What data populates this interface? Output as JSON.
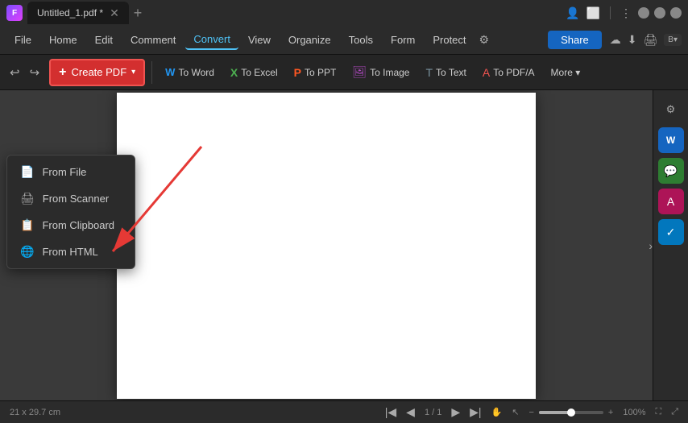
{
  "titleBar": {
    "appName": "Untitled_1.pdf *",
    "logo": "F"
  },
  "menuBar": {
    "items": [
      {
        "id": "file",
        "label": "File"
      },
      {
        "id": "home",
        "label": "Home"
      },
      {
        "id": "edit",
        "label": "Edit"
      },
      {
        "id": "comment",
        "label": "Comment"
      },
      {
        "id": "convert",
        "label": "Convert"
      },
      {
        "id": "view",
        "label": "View"
      },
      {
        "id": "organize",
        "label": "Organize"
      },
      {
        "id": "tools",
        "label": "Tools"
      },
      {
        "id": "form",
        "label": "Form"
      },
      {
        "id": "protect",
        "label": "Protect"
      }
    ],
    "activeItem": "convert",
    "shareLabel": "Share"
  },
  "toolbar": {
    "createPdfLabel": "Create PDF",
    "buttons": [
      {
        "id": "to-word",
        "label": "To Word",
        "iconColor": "word"
      },
      {
        "id": "to-excel",
        "label": "To Excel",
        "iconColor": "excel"
      },
      {
        "id": "to-ppt",
        "label": "To PPT",
        "iconColor": "ppt"
      },
      {
        "id": "to-image",
        "label": "To Image",
        "iconColor": "img"
      },
      {
        "id": "to-text",
        "label": "To Text",
        "iconColor": "text"
      },
      {
        "id": "to-pdfa",
        "label": "To PDF/A",
        "iconColor": "pdf"
      },
      {
        "id": "more",
        "label": "More ▾"
      }
    ]
  },
  "dropdown": {
    "items": [
      {
        "id": "from-file",
        "label": "From File",
        "icon": "📄"
      },
      {
        "id": "from-scanner",
        "label": "From Scanner",
        "icon": "🖨"
      },
      {
        "id": "from-clipboard",
        "label": "From Clipboard",
        "icon": "📋"
      },
      {
        "id": "from-html",
        "label": "From HTML",
        "icon": "🌐"
      }
    ]
  },
  "rightPanel": {
    "icons": [
      {
        "id": "word-icon",
        "label": "W",
        "type": "word"
      },
      {
        "id": "chat-icon",
        "label": "💬",
        "type": "chat"
      },
      {
        "id": "edit-icon",
        "label": "A",
        "type": "edit"
      },
      {
        "id": "check-icon",
        "label": "✓",
        "type": "check"
      }
    ]
  },
  "statusBar": {
    "dimensions": "21 x 29.7 cm",
    "pageInfo": "1 / 1",
    "zoomLevel": "100%"
  }
}
